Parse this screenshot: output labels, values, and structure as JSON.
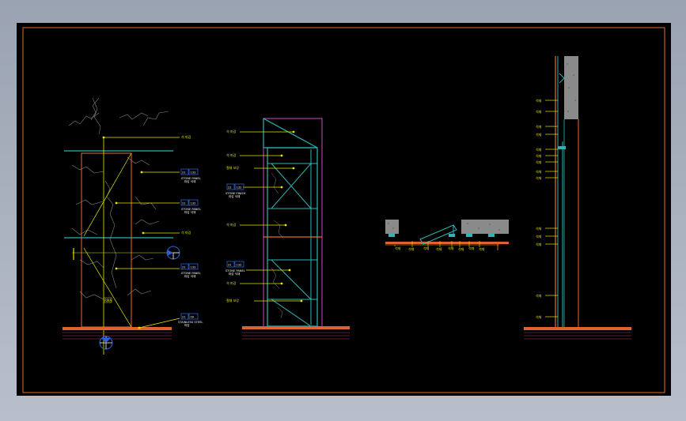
{
  "colors": {
    "background": "#000000",
    "frame": "#e0702a",
    "leader": "#e6e600",
    "steel": "#2fb3b3",
    "cladding": "#c84cc4",
    "stone_texture": "#808080",
    "hatch": "#b04060",
    "floor": "#e06030"
  },
  "elevation": {
    "labels": [
      {
        "text": "석 마감"
      },
      {
        "tag_left": "21",
        "tag_right": "132",
        "text": "STONE PANEL",
        "sub": "마감 석재"
      },
      {
        "tag_left": "21",
        "tag_right": "132",
        "text": "STONE PANEL",
        "sub": "마감 석재"
      },
      {
        "text": "석 마감"
      },
      {
        "tag_left": "21",
        "tag_right": "132",
        "text": "STONE PANEL",
        "sub": "마감 석재"
      },
      {
        "tag_left": "21",
        "tag_right": "09",
        "text": "STAINLESS STEEL",
        "sub": "마감"
      }
    ],
    "marker": "RMA"
  },
  "section": {
    "labels": [
      {
        "text": "석 마감"
      },
      {
        "text": "석 마감"
      },
      {
        "text": "철재 보강"
      },
      {
        "tag_left": "21",
        "tag_right": "132",
        "text": "STONE FINISH",
        "sub": "마감 석재"
      },
      {
        "text": "석 마감"
      },
      {
        "tag_left": "21",
        "tag_right": "132",
        "text": "STONE PANEL",
        "sub": "마감 석재"
      },
      {
        "text": "석 마감"
      },
      {
        "text": "철재 보강"
      }
    ]
  },
  "detail": {
    "labels": [
      "석재",
      "석재",
      "석재",
      "석재",
      "석재",
      "석재",
      "석재",
      "석재"
    ]
  },
  "wall_section": {
    "labels": [
      "석재",
      "석재",
      "석재",
      "석재",
      "석재",
      "석재",
      "석재",
      "석재",
      "석재",
      "석재",
      "석재",
      "석재",
      "석재",
      "석재"
    ]
  }
}
